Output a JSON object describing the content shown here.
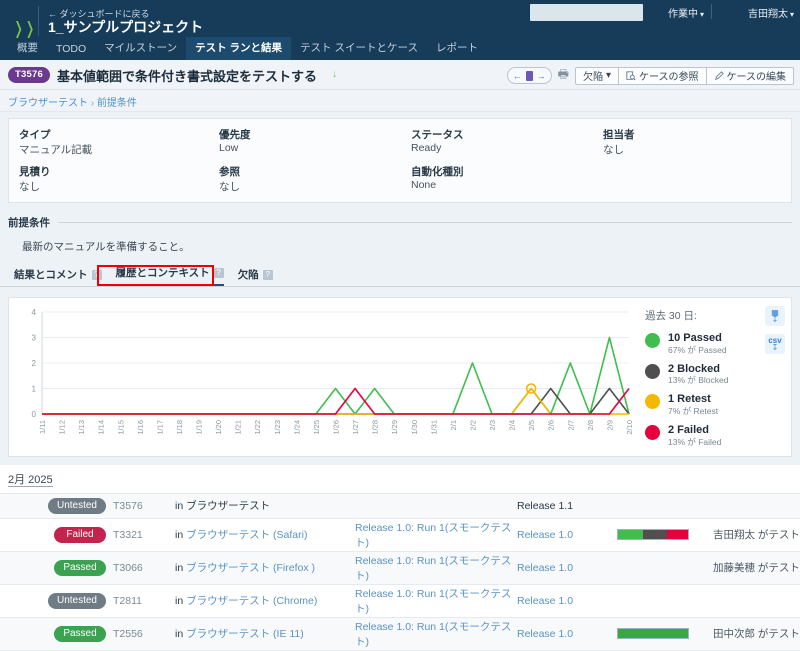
{
  "topbar": {
    "logo_icon": "chevron-logo-icon",
    "back_link": "← ダッシュボードに戻る",
    "project_title": "1_サンプルプロジェクト",
    "search_placeholder": "",
    "search_value": "",
    "search_icon": "search-icon",
    "status_menu": "作業中",
    "user_menu": "吉田翔太",
    "caret": "⌄",
    "nav_tabs": [
      {
        "label": "概要",
        "active": false
      },
      {
        "label": "TODO",
        "active": false
      },
      {
        "label": "マイルストーン",
        "active": false
      },
      {
        "label": "テスト ランと結果",
        "active": true
      },
      {
        "label": "テスト スイートとケース",
        "active": false
      },
      {
        "label": "レポート",
        "active": false
      }
    ]
  },
  "case": {
    "id_badge": "T3576",
    "title": "基本値範囲で条件付き書式設定をテストする",
    "title_caret": "↓",
    "pager": {
      "prev": "←",
      "next": "→",
      "icon": "case-marker-icon"
    },
    "print_icon": "printer-icon",
    "defect_select": "欠陥",
    "defect_caret": "⌄",
    "view_case_button": "ケースの参照",
    "view_case_icon": "magnifier-document-icon",
    "edit_case_button": "ケースの編集",
    "edit_case_icon": "pencil-icon",
    "breadcrumb": {
      "root": "ブラウザーテスト",
      "sep": "›",
      "leaf": "前提条件"
    }
  },
  "details": {
    "fields": [
      {
        "label": "タイプ",
        "value": "マニュアル記載"
      },
      {
        "label": "優先度",
        "value": "Low"
      },
      {
        "label": "ステータス",
        "value": "Ready"
      },
      {
        "label": "担当者",
        "value": "なし"
      },
      {
        "label": "見積り",
        "value": "なし"
      },
      {
        "label": "参照",
        "value": "なし"
      },
      {
        "label": "自動化種別",
        "value": "None"
      },
      {
        "label": "",
        "value": ""
      }
    ]
  },
  "preconditions": {
    "heading": "前提条件",
    "text": "最新のマニュアルを準備すること。"
  },
  "subtabs": [
    {
      "label": "結果とコメント",
      "help": "?",
      "active": false,
      "highlighted": false
    },
    {
      "label": "履歴とコンテキスト",
      "help": "?",
      "active": true,
      "highlighted": true
    },
    {
      "label": "欠陥",
      "help": "?",
      "active": false,
      "highlighted": false
    }
  ],
  "chart_data": {
    "type": "line",
    "title": "",
    "legend_title": "過去 30 日:",
    "xlabel": "",
    "ylabel": "",
    "ylim": [
      0,
      4
    ],
    "yticks": [
      0,
      1,
      2,
      3,
      4
    ],
    "grid": true,
    "legend_position": "right",
    "x": [
      "1/11",
      "1/12",
      "1/13",
      "1/14",
      "1/15",
      "1/16",
      "1/17",
      "1/18",
      "1/19",
      "1/20",
      "1/21",
      "1/22",
      "1/23",
      "1/24",
      "1/25",
      "1/26",
      "1/27",
      "1/28",
      "1/29",
      "1/30",
      "1/31",
      "2/1",
      "2/2",
      "2/3",
      "2/4",
      "2/5",
      "2/6",
      "2/7",
      "2/8",
      "2/9",
      "2/10"
    ],
    "series": [
      {
        "name": "Passed",
        "color": "#3fbe4f",
        "values": [
          0,
          0,
          0,
          0,
          0,
          0,
          0,
          0,
          0,
          0,
          0,
          0,
          0,
          0,
          0,
          1,
          0,
          1,
          0,
          0,
          0,
          0,
          2,
          0,
          0,
          1,
          0,
          2,
          0,
          3,
          0
        ]
      },
      {
        "name": "Blocked",
        "color": "#4f4f4f",
        "values": [
          0,
          0,
          0,
          0,
          0,
          0,
          0,
          0,
          0,
          0,
          0,
          0,
          0,
          0,
          0,
          0,
          0,
          0,
          0,
          0,
          0,
          0,
          0,
          0,
          0,
          0,
          1,
          0,
          0,
          1,
          0
        ]
      },
      {
        "name": "Retest",
        "color": "#f5b800",
        "values": [
          0,
          0,
          0,
          0,
          0,
          0,
          0,
          0,
          0,
          0,
          0,
          0,
          0,
          0,
          0,
          0,
          0,
          0,
          0,
          0,
          0,
          0,
          0,
          0,
          0,
          1,
          0,
          0,
          0,
          0,
          0
        ]
      },
      {
        "name": "Failed",
        "color": "#e6003c",
        "values": [
          0,
          0,
          0,
          0,
          0,
          0,
          0,
          0,
          0,
          0,
          0,
          0,
          0,
          0,
          0,
          0,
          1,
          0,
          0,
          0,
          0,
          0,
          0,
          0,
          0,
          0,
          0,
          0,
          0,
          0,
          1
        ]
      }
    ],
    "legend": [
      {
        "count": "10 Passed",
        "pct": "67% が Passed",
        "color": "#3fbe4f"
      },
      {
        "count": "2 Blocked",
        "pct": "13% が Blocked",
        "color": "#4f4f4f"
      },
      {
        "count": "1 Retest",
        "pct": "7% が Retest",
        "color": "#f5b800"
      },
      {
        "count": "2 Failed",
        "pct": "13% が Failed",
        "color": "#e6003c"
      }
    ],
    "exports": [
      {
        "name": "export-chart-image-button",
        "glyph": "▰",
        "arrow": "↓"
      },
      {
        "name": "export-csv-button",
        "glyph": "csv",
        "arrow": "↓"
      }
    ]
  },
  "results": {
    "month_heading": "2月 2025",
    "rows": [
      {
        "status": "Untested",
        "status_class": "untested",
        "id": "T3576",
        "in_label": "in",
        "where": "ブラウザーテスト",
        "where_link": false,
        "run": "",
        "release": "Release 1.1",
        "bar": [],
        "who": ""
      },
      {
        "status": "Failed",
        "status_class": "failed",
        "id": "T3321",
        "in_label": "in",
        "where": "ブラウザーテスト (Safari)",
        "where_link": true,
        "run": "Release 1.0: Run 1(スモークテスト)",
        "release": "Release 1.0",
        "bar": [
          {
            "color": "#3fbe4f",
            "pct": 36
          },
          {
            "color": "#4f4f4f",
            "pct": 34
          },
          {
            "color": "#e6003c",
            "pct": 30
          }
        ],
        "who": "吉田翔太 がテスト"
      },
      {
        "status": "Passed",
        "status_class": "passed",
        "id": "T3066",
        "in_label": "in",
        "where": "ブラウザーテスト (Firefox )",
        "where_link": true,
        "run": "Release 1.0: Run 1(スモークテスト)",
        "release": "Release 1.0",
        "bar": [],
        "who": "加藤美穂 がテスト"
      },
      {
        "status": "Untested",
        "status_class": "untested",
        "id": "T2811",
        "in_label": "in",
        "where": "ブラウザーテスト (Chrome)",
        "where_link": true,
        "run": "Release 1.0: Run 1(スモークテスト)",
        "release": "Release 1.0",
        "bar": [],
        "who": ""
      },
      {
        "status": "Passed",
        "status_class": "passed",
        "id": "T2556",
        "in_label": "in",
        "where": "ブラウザーテスト (IE 11)",
        "where_link": true,
        "run": "Release 1.0: Run 1(スモークテスト)",
        "release": "Release 1.0",
        "bar": [
          {
            "color": "#3aa83f",
            "pct": 100
          }
        ],
        "who": "田中次郎 がテスト"
      }
    ]
  }
}
